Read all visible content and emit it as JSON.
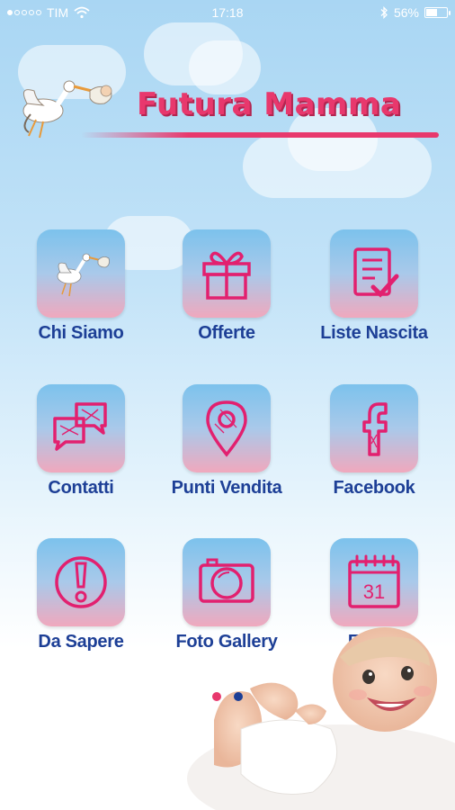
{
  "status_bar": {
    "carrier": "TIM",
    "time": "17:18",
    "battery": "56%",
    "battery_level": 0.56,
    "signal_bars": 1,
    "icons": [
      "signal-icon",
      "wifi-icon",
      "bluetooth-icon",
      "battery-icon"
    ]
  },
  "header": {
    "title": "Futura Mamma",
    "logo_icon": "stork-icon"
  },
  "menu": [
    {
      "label": "Chi Siamo",
      "icon": "stork-icon"
    },
    {
      "label": "Offerte",
      "icon": "gift-icon"
    },
    {
      "label": "Liste Nascita",
      "icon": "checklist-icon"
    },
    {
      "label": "Contatti",
      "icon": "chat-bubbles-icon"
    },
    {
      "label": "Punti Vendita",
      "icon": "map-pin-icon"
    },
    {
      "label": "Facebook",
      "icon": "facebook-icon"
    },
    {
      "label": "Da Sapere",
      "icon": "exclamation-icon"
    },
    {
      "label": "Foto Gallery",
      "icon": "camera-icon"
    },
    {
      "label": "Eventi",
      "icon": "calendar-icon"
    }
  ],
  "calendar_day": "31",
  "pager": {
    "pages": 2,
    "current_page": 2
  },
  "colors": {
    "brand_pink": "#e8386d",
    "label_blue": "#1d3f96",
    "dot_active": "#1d3f96",
    "dot_inactive": "#e8386d"
  }
}
